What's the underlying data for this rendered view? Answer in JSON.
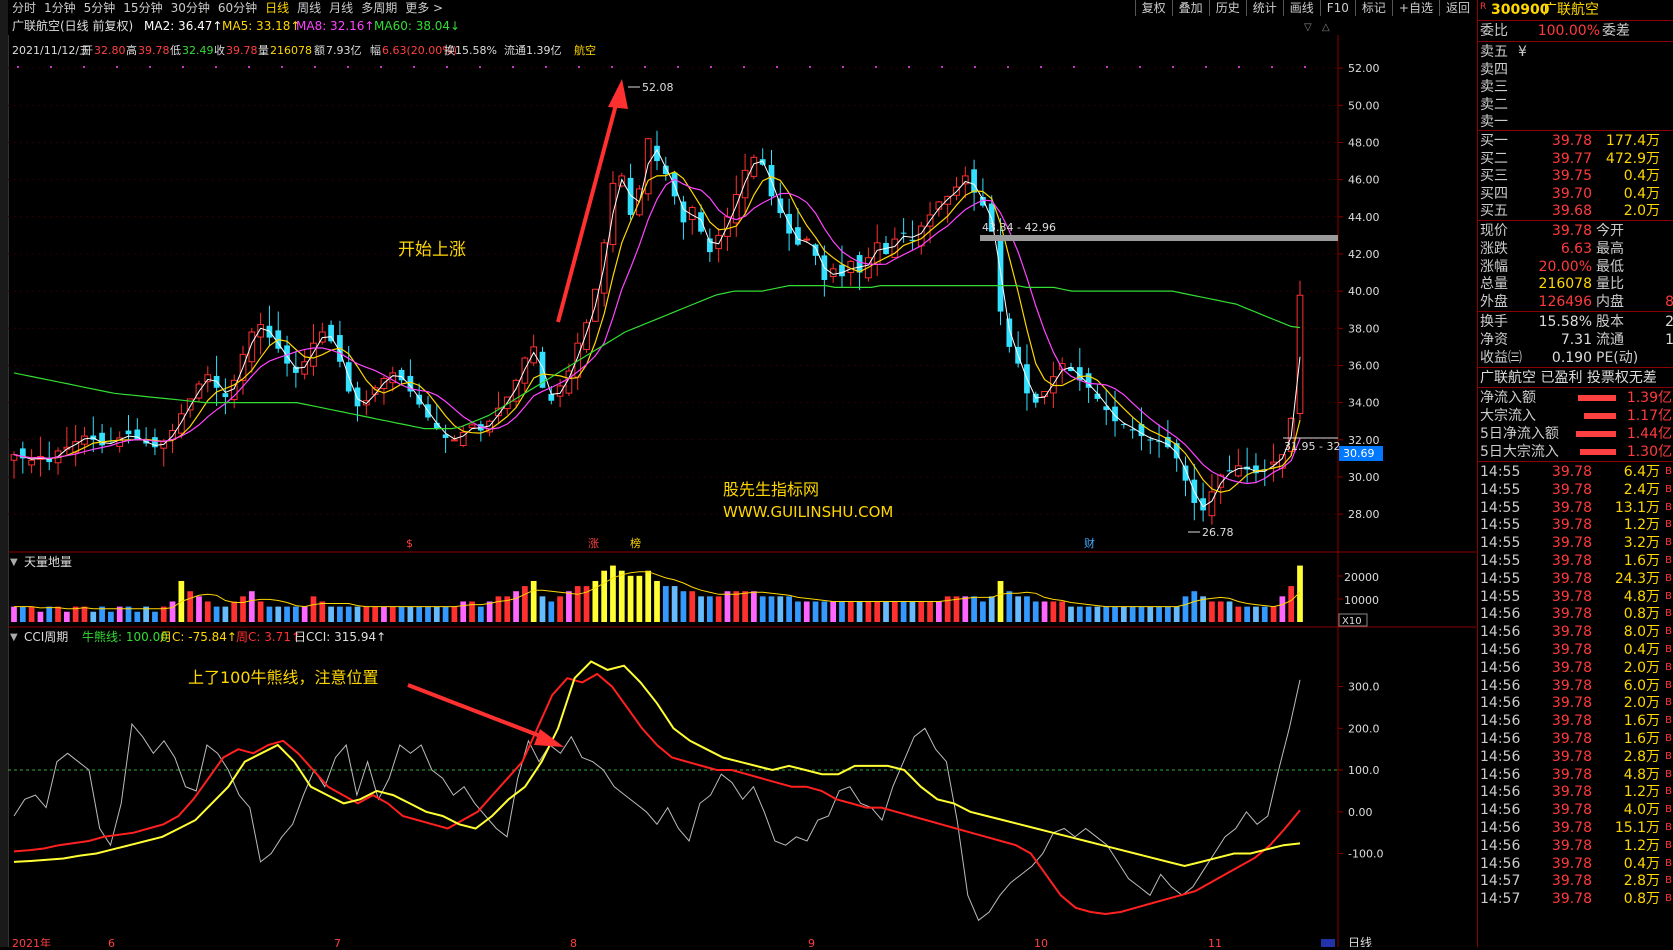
{
  "topbar": {
    "tabs": [
      "分时",
      "1分钟",
      "5分钟",
      "15分钟",
      "30分钟",
      "60分钟",
      "日线",
      "周线",
      "月线",
      "多周期",
      "更多 >"
    ],
    "active_tab": "日线",
    "tools": [
      "复权",
      "叠加",
      "历史",
      "统计",
      "画线",
      "F10",
      "标记",
      "+自选",
      "返回"
    ]
  },
  "main": {
    "title": "广联航空(日线 前复权)",
    "ma": [
      {
        "label": "MA2: 36.47↑",
        "color": "#ffffff"
      },
      {
        "label": "MA5: 33.18↑",
        "color": "#ffd700"
      },
      {
        "label": "MA8: 32.16↑",
        "color": "#ff44ff"
      },
      {
        "label": "MA60: 38.04↓",
        "color": "#33dd33"
      }
    ],
    "info": {
      "date": "2021/11/12/五",
      "open_label": "开",
      "open": "32.80",
      "high_label": "高",
      "high": "39.78",
      "low_label": "低",
      "low": "32.49",
      "close_label": "收",
      "close": "39.78",
      "vol_label": "量",
      "vol": "216078",
      "amt_label": "额",
      "amt": "7.93亿",
      "chg_label": "幅",
      "chg": "6.63(20.00%)",
      "turn": "换15.58%",
      "float": "流通1.39亿",
      "sector": "航空"
    },
    "price_axis": [
      "52.00",
      "50.00",
      "48.00",
      "46.00",
      "44.00",
      "42.00",
      "40.00",
      "38.00",
      "36.00",
      "34.00",
      "32.00",
      "30.00",
      "28.00"
    ],
    "current_price_tag": "30.69",
    "high_marker": "52.08",
    "low_marker": "26.78",
    "zone1": "43.34 - 42.96",
    "zone2": "31.95 - 32",
    "annotation1": "开始上涨",
    "watermark1": "股先生指标网",
    "watermark2": "WWW.GUILINSHU.COM",
    "event_marks": [
      "$",
      "涨",
      "榜",
      "财"
    ]
  },
  "volume": {
    "title": "天量地量",
    "axis": [
      "20000",
      "10000"
    ],
    "unit": "X10"
  },
  "cci": {
    "title": "CCI周期",
    "bull_label": "牛熊线: 100.00",
    "month_label": "月C: -75.84↑",
    "week_label": "周C: 3.71↑",
    "day_label": "日CCI: 315.94↑",
    "axis": [
      "300.0",
      "200.0",
      "100.0",
      "0.00",
      "-100.0"
    ],
    "annotation": "上了100牛熊线，注意位置",
    "date_marks": [
      "2021年",
      "6",
      "7",
      "8",
      "9",
      "10",
      "11"
    ],
    "period": "日线"
  },
  "quote": {
    "code": "300900",
    "name": "广联航空",
    "weibi_label": "委比",
    "weibi": "100.00%",
    "weicha_label": "委差",
    "sell": [
      {
        "label": "卖五",
        "price": "¥",
        "vol": ""
      },
      {
        "label": "卖四",
        "price": "",
        "vol": ""
      },
      {
        "label": "卖三",
        "price": "",
        "vol": ""
      },
      {
        "label": "卖二",
        "price": "",
        "vol": ""
      },
      {
        "label": "卖一",
        "price": "",
        "vol": ""
      }
    ],
    "buy": [
      {
        "label": "买一",
        "price": "39.78",
        "vol": "177.4万"
      },
      {
        "label": "买二",
        "price": "39.77",
        "vol": "472.9万"
      },
      {
        "label": "买三",
        "price": "39.75",
        "vol": "0.4万"
      },
      {
        "label": "买四",
        "price": "39.70",
        "vol": "0.4万"
      },
      {
        "label": "买五",
        "price": "39.68",
        "vol": "2.0万"
      }
    ],
    "stats": [
      {
        "l1": "现价",
        "v1": "39.78",
        "c1": "red",
        "l2": "今开"
      },
      {
        "l1": "涨跌",
        "v1": "6.63",
        "c1": "red",
        "l2": "最高"
      },
      {
        "l1": "涨幅",
        "v1": "20.00%",
        "c1": "red",
        "l2": "最低"
      },
      {
        "l1": "总量",
        "v1": "216078",
        "c1": "yellow",
        "l2": "量比"
      },
      {
        "l1": "外盘",
        "v1": "126496",
        "c1": "red",
        "l2": "内盘",
        "v2": "8"
      }
    ],
    "stats2": [
      {
        "l1": "换手",
        "v1": "15.58%",
        "l2": "股本",
        "v2": "2"
      },
      {
        "l1": "净资",
        "v1": "7.31",
        "l2": "流通",
        "v2": "1"
      },
      {
        "l1": "收益㈢",
        "v1": "0.190",
        "l2": "PE(动)",
        "v2": ""
      }
    ],
    "tags": "广联航空 已盈利 投票权无差",
    "flows": [
      {
        "label": "净流入额",
        "value": "1.39亿",
        "bar": 38
      },
      {
        "label": "大宗流入",
        "value": "1.17亿",
        "bar": 32
      },
      {
        "label": "5日净流入额",
        "value": "1.44亿",
        "bar": 40
      },
      {
        "label": "5日大宗流入",
        "value": "1.30亿",
        "bar": 36
      }
    ],
    "ticks": [
      {
        "t": "14:55",
        "p": "39.78",
        "v": "6.4万"
      },
      {
        "t": "14:55",
        "p": "39.78",
        "v": "2.4万"
      },
      {
        "t": "14:55",
        "p": "39.78",
        "v": "13.1万"
      },
      {
        "t": "14:55",
        "p": "39.78",
        "v": "1.2万"
      },
      {
        "t": "14:55",
        "p": "39.78",
        "v": "3.2万"
      },
      {
        "t": "14:55",
        "p": "39.78",
        "v": "1.6万"
      },
      {
        "t": "14:55",
        "p": "39.78",
        "v": "24.3万"
      },
      {
        "t": "14:55",
        "p": "39.78",
        "v": "4.8万"
      },
      {
        "t": "14:56",
        "p": "39.78",
        "v": "0.8万"
      },
      {
        "t": "14:56",
        "p": "39.78",
        "v": "8.0万"
      },
      {
        "t": "14:56",
        "p": "39.78",
        "v": "0.4万"
      },
      {
        "t": "14:56",
        "p": "39.78",
        "v": "2.0万"
      },
      {
        "t": "14:56",
        "p": "39.78",
        "v": "6.0万"
      },
      {
        "t": "14:56",
        "p": "39.78",
        "v": "2.0万"
      },
      {
        "t": "14:56",
        "p": "39.78",
        "v": "1.6万"
      },
      {
        "t": "14:56",
        "p": "39.78",
        "v": "1.6万"
      },
      {
        "t": "14:56",
        "p": "39.78",
        "v": "2.8万"
      },
      {
        "t": "14:56",
        "p": "39.78",
        "v": "4.8万"
      },
      {
        "t": "14:56",
        "p": "39.78",
        "v": "1.2万"
      },
      {
        "t": "14:56",
        "p": "39.78",
        "v": "4.0万"
      },
      {
        "t": "14:56",
        "p": "39.78",
        "v": "15.1万"
      },
      {
        "t": "14:56",
        "p": "39.78",
        "v": "1.2万"
      },
      {
        "t": "14:56",
        "p": "39.78",
        "v": "0.4万"
      },
      {
        "t": "14:57",
        "p": "39.78",
        "v": "2.8万"
      },
      {
        "t": "14:57",
        "p": "39.78",
        "v": "0.8万"
      }
    ]
  },
  "chart_data": {
    "type": "candlestick",
    "closes": [
      31.2,
      31.0,
      30.9,
      31.1,
      30.8,
      31.4,
      31.6,
      31.9,
      32.2,
      32.0,
      31.7,
      31.9,
      32.1,
      32.3,
      32.0,
      31.8,
      31.6,
      31.9,
      32.5,
      33.4,
      34.2,
      35.0,
      35.5,
      34.8,
      34.3,
      35.2,
      36.6,
      37.8,
      38.2,
      37.5,
      36.9,
      36.1,
      35.6,
      36.2,
      37.2,
      37.8,
      37.3,
      36.2,
      34.6,
      33.8,
      34.1,
      34.8,
      35.3,
      35.6,
      35.2,
      34.6,
      33.9,
      33.2,
      32.6,
      32.1,
      32.0,
      32.4,
      32.8,
      32.5,
      33.0,
      33.7,
      34.3,
      35.2,
      36.4,
      37.0,
      34.8,
      34.1,
      34.9,
      35.7,
      37.2,
      38.3,
      40.1,
      42.6,
      45.8,
      46.2,
      44.1,
      45.5,
      48.2,
      47.0,
      46.3,
      45.1,
      43.7,
      44.5,
      43.2,
      42.1,
      43.0,
      44.0,
      45.2,
      46.5,
      47.2,
      46.8,
      45.1,
      44.2,
      43.1,
      42.5,
      42.8,
      41.9,
      40.6,
      41.2,
      40.8,
      41.6,
      41.0,
      41.8,
      42.6,
      42.0,
      42.8,
      43.1,
      42.7,
      43.5,
      44.1,
      44.8,
      45.1,
      45.6,
      46.2,
      45.3,
      44.6,
      43.2,
      38.9,
      37.0,
      36.1,
      34.5,
      34.0,
      34.6,
      35.4,
      36.1,
      35.7,
      35.2,
      34.8,
      34.2,
      33.6,
      33.0,
      32.8,
      32.5,
      32.2,
      32.0,
      31.9,
      31.6,
      31.0,
      29.8,
      28.6,
      28.2,
      29.2,
      30.1,
      30.3,
      30.6,
      30.4,
      30.2,
      30.4,
      30.8,
      31.2,
      33.15,
      39.78
    ],
    "price_range": [
      26.5,
      52.6
    ],
    "ma60": [
      35.6,
      35.5,
      35.4,
      35.3,
      35.2,
      35.1,
      35.0,
      34.9,
      34.8,
      34.7,
      34.6,
      34.5,
      34.45,
      34.4,
      34.35,
      34.3,
      34.25,
      34.2,
      34.15,
      34.1,
      34.05,
      34.0,
      34.0,
      34.0,
      34.0,
      34.0,
      34.0,
      34.0,
      34.0,
      34.0,
      34.0,
      34.0,
      33.9,
      33.8,
      33.7,
      33.6,
      33.5,
      33.4,
      33.3,
      33.2,
      33.1,
      33.0,
      32.9,
      32.8,
      32.7,
      32.6,
      32.6,
      32.6,
      32.6,
      32.7,
      32.9,
      33.1,
      33.3,
      33.6,
      33.9,
      34.2,
      34.5,
      34.8,
      35.1,
      35.4,
      35.7,
      36.0,
      36.3,
      36.6,
      36.9,
      37.2,
      37.5,
      37.8,
      38.0,
      38.2,
      38.4,
      38.6,
      38.8,
      39.0,
      39.2,
      39.4,
      39.6,
      39.8,
      39.9,
      40.0,
      40.0,
      40.0,
      40.0,
      40.1,
      40.2,
      40.3,
      40.3,
      40.3,
      40.3,
      40.3,
      40.2,
      40.2,
      40.2,
      40.2,
      40.2,
      40.3,
      40.3,
      40.3,
      40.3,
      40.3,
      40.3,
      40.3,
      40.3,
      40.3,
      40.3,
      40.3,
      40.3,
      40.3,
      40.3,
      40.3,
      40.3,
      40.2,
      40.2,
      40.2,
      40.2,
      40.1,
      40.0,
      40.0,
      40.0,
      40.0,
      40.0,
      40.0,
      40.0,
      40.0,
      40.0,
      40.0,
      40.0,
      40.0,
      39.9,
      39.8,
      39.7,
      39.6,
      39.5,
      39.4,
      39.3,
      39.1,
      38.9,
      38.7,
      38.5,
      38.3,
      38.1,
      38.04
    ],
    "cci_day": [
      -10,
      30,
      40,
      10,
      120,
      140,
      120,
      100,
      -40,
      -80,
      20,
      210,
      180,
      140,
      170,
      130,
      60,
      50,
      160,
      140,
      100,
      40,
      10,
      -120,
      -100,
      -60,
      -30,
      40,
      100,
      60,
      130,
      160,
      40,
      120,
      30,
      80,
      160,
      140,
      160,
      100,
      80,
      40,
      60,
      20,
      -10,
      -40,
      -60,
      80,
      170,
      120,
      160,
      140,
      180,
      130,
      120,
      100,
      60,
      40,
      20,
      0,
      -30,
      10,
      -40,
      -70,
      20,
      40,
      90,
      70,
      30,
      60,
      0,
      -70,
      -80,
      -60,
      -70,
      -20,
      -10,
      50,
      60,
      20,
      10,
      -20,
      60,
      120,
      180,
      200,
      150,
      120,
      -20,
      -200,
      -260,
      -240,
      -200,
      -170,
      -150,
      -130,
      -100,
      -50,
      -40,
      -60,
      -40,
      -60,
      -80,
      -120,
      -160,
      -180,
      -200,
      -150,
      -180,
      -200,
      -180,
      -140,
      -100,
      -60,
      -40,
      0,
      -30,
      -10,
      100,
      200,
      316
    ],
    "cci_week": [
      -95,
      -92,
      -88,
      -80,
      -75,
      -70,
      -60,
      -55,
      -50,
      -40,
      -30,
      -10,
      30,
      80,
      130,
      150,
      140,
      160,
      170,
      140,
      100,
      60,
      40,
      20,
      40,
      20,
      -10,
      -20,
      -30,
      -40,
      -20,
      0,
      40,
      80,
      120,
      200,
      280,
      320,
      310,
      330,
      300,
      250,
      200,
      160,
      130,
      120,
      110,
      100,
      100,
      90,
      80,
      70,
      60,
      60,
      50,
      30,
      20,
      10,
      10,
      0,
      -10,
      -20,
      -30,
      -40,
      -50,
      -60,
      -70,
      -80,
      -100,
      -150,
      -200,
      -230,
      -240,
      -245,
      -240,
      -230,
      -220,
      -210,
      -200,
      -190,
      -170,
      -150,
      -130,
      -110,
      -80,
      -40,
      3.71
    ],
    "cci_month": [
      -120,
      -118,
      -115,
      -112,
      -105,
      -100,
      -90,
      -80,
      -70,
      -60,
      -40,
      -20,
      20,
      60,
      120,
      140,
      160,
      120,
      60,
      40,
      20,
      30,
      50,
      40,
      20,
      0,
      -10,
      -30,
      -40,
      -10,
      30,
      60,
      120,
      200,
      320,
      360,
      340,
      350,
      310,
      260,
      200,
      170,
      150,
      130,
      120,
      110,
      100,
      110,
      100,
      90,
      90,
      110,
      110,
      110,
      100,
      60,
      30,
      20,
      0,
      -10,
      -20,
      -30,
      -40,
      -50,
      -60,
      -70,
      -80,
      -90,
      -100,
      -110,
      -120,
      -130,
      -120,
      -110,
      -100,
      -100,
      -90,
      -80,
      -75.84
    ],
    "volumes_rel": [
      0.3,
      0.3,
      0.3,
      0.2,
      0.3,
      0.3,
      0.2,
      0.3,
      0.3,
      0.2,
      0.3,
      0.2,
      0.3,
      0.3,
      0.2,
      0.3,
      0.2,
      0.3,
      0.4,
      0.8,
      0.6,
      0.5,
      0.4,
      0.3,
      0.3,
      0.4,
      0.5,
      0.6,
      0.4,
      0.3,
      0.3,
      0.3,
      0.3,
      0.3,
      0.5,
      0.4,
      0.3,
      0.3,
      0.3,
      0.3,
      0.3,
      0.3,
      0.3,
      0.3,
      0.3,
      0.3,
      0.3,
      0.3,
      0.3,
      0.3,
      0.3,
      0.4,
      0.4,
      0.3,
      0.4,
      0.5,
      0.5,
      0.6,
      0.7,
      0.8,
      0.5,
      0.4,
      0.5,
      0.6,
      0.7,
      0.7,
      0.8,
      1.0,
      1.1,
      1.0,
      0.9,
      0.9,
      1.0,
      0.8,
      0.7,
      0.7,
      0.6,
      0.6,
      0.5,
      0.5,
      0.5,
      0.6,
      0.6,
      0.6,
      0.6,
      0.5,
      0.5,
      0.5,
      0.5,
      0.4,
      0.4,
      0.4,
      0.4,
      0.4,
      0.4,
      0.4,
      0.4,
      0.4,
      0.4,
      0.4,
      0.4,
      0.4,
      0.4,
      0.4,
      0.4,
      0.4,
      0.5,
      0.5,
      0.5,
      0.5,
      0.4,
      0.5,
      0.8,
      0.6,
      0.5,
      0.5,
      0.4,
      0.4,
      0.4,
      0.4,
      0.3,
      0.3,
      0.3,
      0.3,
      0.3,
      0.3,
      0.3,
      0.3,
      0.3,
      0.3,
      0.3,
      0.3,
      0.3,
      0.5,
      0.6,
      0.5,
      0.4,
      0.4,
      0.4,
      0.3,
      0.3,
      0.3,
      0.3,
      0.3,
      0.5,
      0.7,
      1.1
    ]
  }
}
